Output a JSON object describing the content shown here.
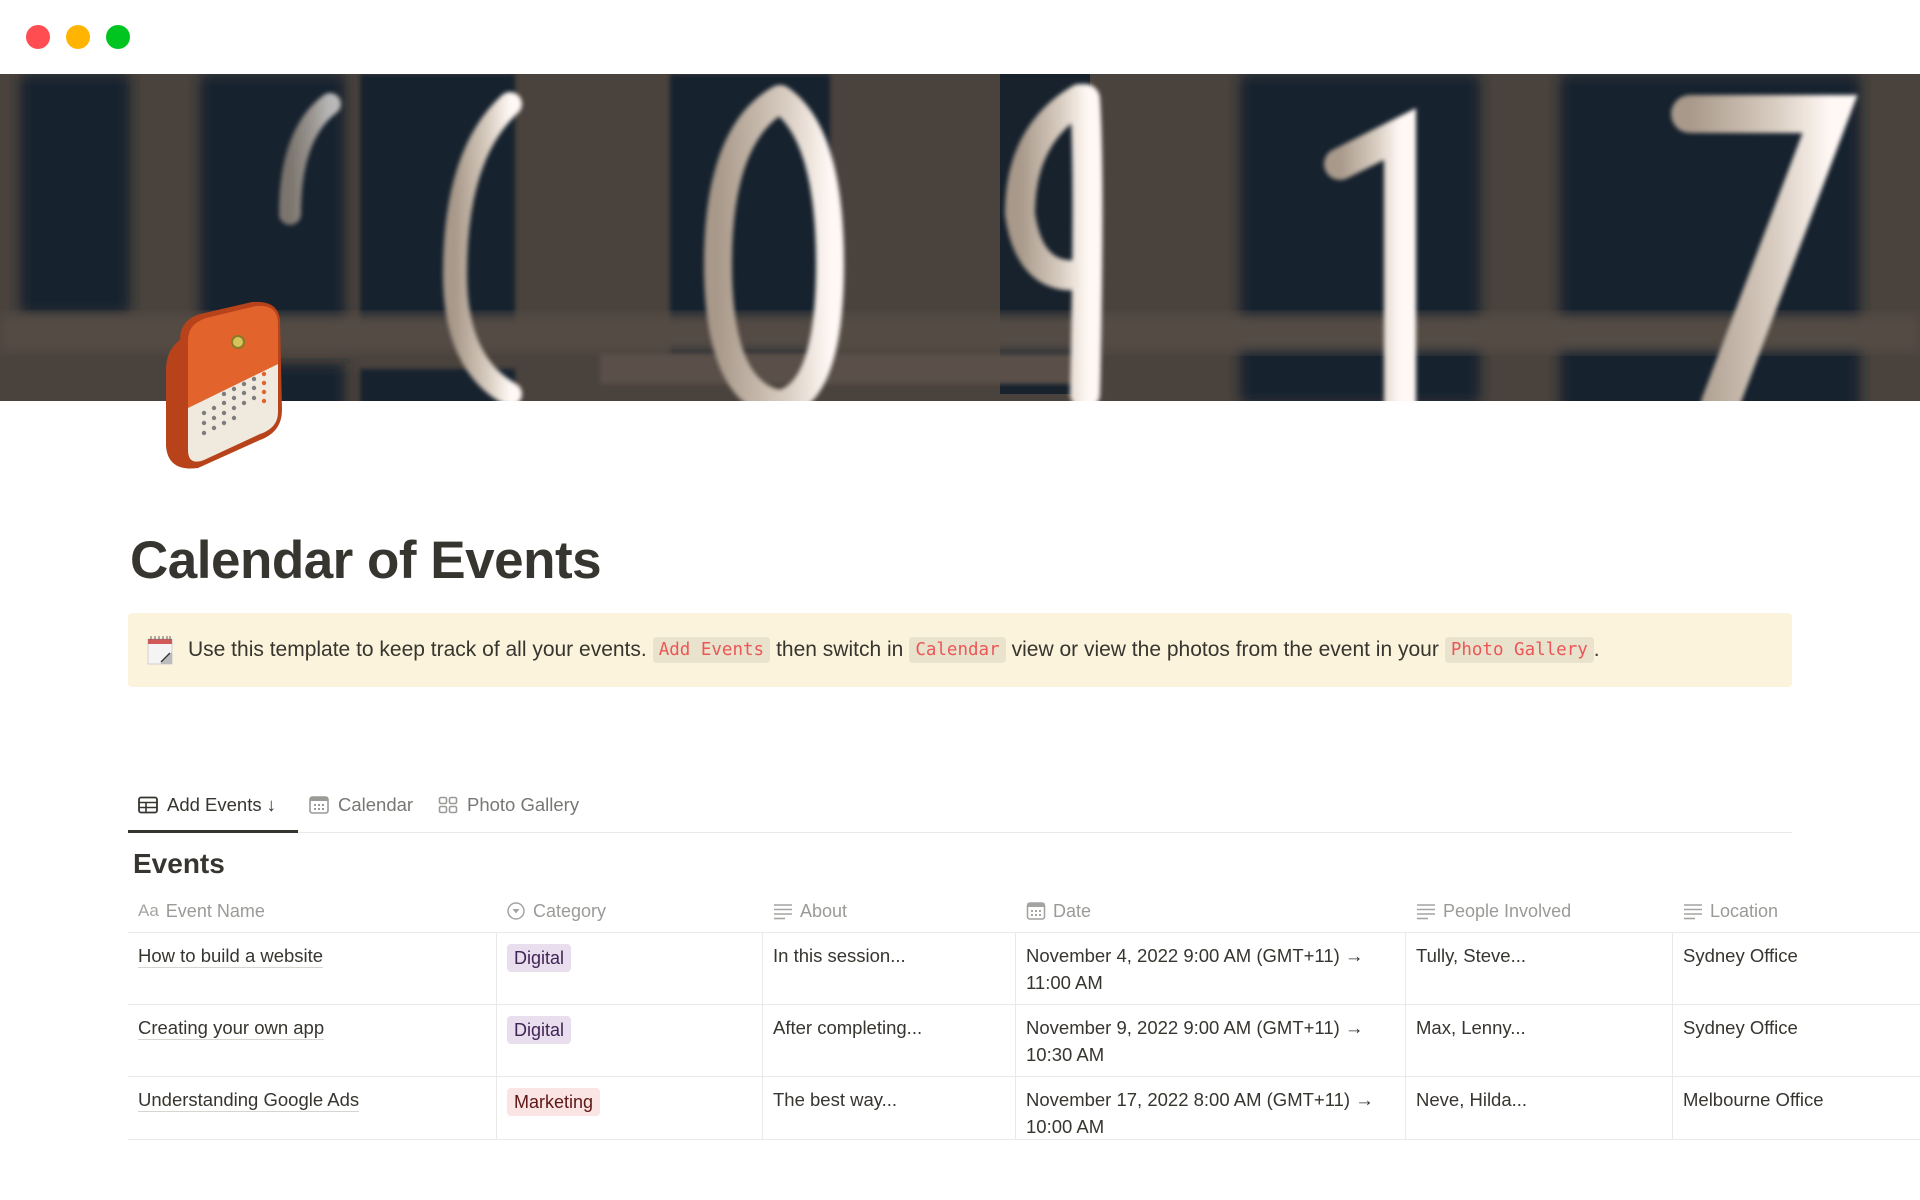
{
  "window": {
    "controls": [
      "close",
      "minimize",
      "maximize"
    ]
  },
  "page": {
    "title": "Calendar of Events",
    "icon": "calendar-icon",
    "cover": "numbers-photo"
  },
  "callout": {
    "icon": "spiral-calendar-icon",
    "text_1": "Use this template to keep track of all your events.",
    "code_1": "Add Events",
    "text_2": "then switch in",
    "code_2": "Calendar",
    "text_3": "view or view the photos from the event in your",
    "code_3": "Photo Gallery",
    "text_4": "."
  },
  "views": {
    "tabs": [
      {
        "label": "Add Events",
        "icon": "table-icon",
        "suffix": "↓",
        "active": true
      },
      {
        "label": "Calendar",
        "icon": "calendar-icon",
        "active": false
      },
      {
        "label": "Photo Gallery",
        "icon": "gallery-icon",
        "active": false
      }
    ]
  },
  "database": {
    "title": "Events",
    "columns": [
      {
        "label": "Event Name",
        "icon": "Aa"
      },
      {
        "label": "Category",
        "icon": "select-icon"
      },
      {
        "label": "About",
        "icon": "text-icon"
      },
      {
        "label": "Date",
        "icon": "date-icon"
      },
      {
        "label": "People Involved",
        "icon": "text-icon"
      },
      {
        "label": "Location",
        "icon": "text-icon"
      }
    ],
    "rows": [
      {
        "name": "How to build a website",
        "category": "Digital",
        "about": "In this session...",
        "date_line1": "November 4, 2022 9:00 AM (GMT+11) →",
        "date_line2": "11:00 AM",
        "people": "Tully, Steve...",
        "location": "Sydney Office"
      },
      {
        "name": "Creating your own app",
        "category": "Digital",
        "about": "After completing...",
        "date_line1": "November 9, 2022 9:00 AM (GMT+11) →",
        "date_line2": "10:30 AM",
        "people": "Max, Lenny...",
        "location": "Sydney Office"
      },
      {
        "name": "Understanding Google Ads",
        "category": "Marketing",
        "about": "The best way...",
        "date_line1": "November 17, 2022 8:00 AM (GMT+11) →",
        "date_line2": "10:00 AM",
        "people": "Neve, Hilda...",
        "location": "Melbourne Office"
      }
    ]
  },
  "colors": {
    "tag_digital_bg": "#e8deee",
    "tag_digital_text": "#412454",
    "tag_marketing_bg": "#fbe4e4",
    "tag_marketing_text": "#5d1715",
    "callout_bg": "#fbf3db",
    "inline_code": "#eb5757"
  }
}
